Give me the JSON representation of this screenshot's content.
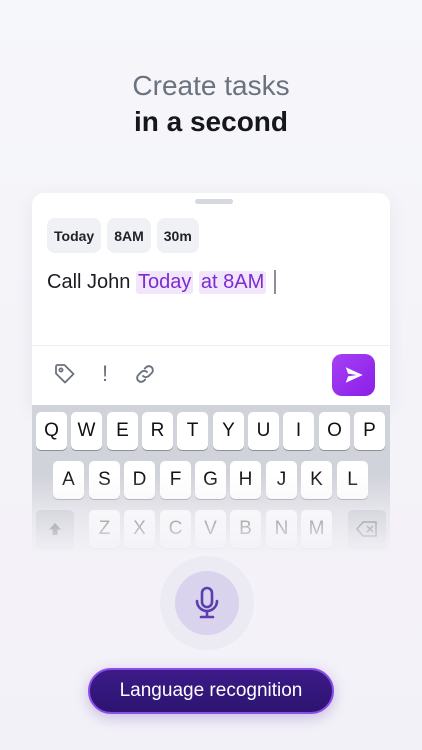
{
  "headline": {
    "line1": "Create tasks",
    "line2": "in a second"
  },
  "chips": [
    {
      "label": "Today"
    },
    {
      "label": "8AM"
    },
    {
      "label": "30m"
    }
  ],
  "task": {
    "text": "Call John",
    "highlight_date": "Today",
    "highlight_time": "at 8AM"
  },
  "toolbar": {
    "priority_symbol": "!"
  },
  "colors": {
    "accent": "#8a1fe6",
    "highlight_bg": "#f1e6fb",
    "highlight_text": "#7c2ccf",
    "button_bg": "#2c1470"
  },
  "keyboard": {
    "row1": [
      "Q",
      "W",
      "E",
      "R",
      "T",
      "Y",
      "U",
      "I",
      "O",
      "P"
    ],
    "row2": [
      "A",
      "S",
      "D",
      "F",
      "G",
      "H",
      "J",
      "K",
      "L"
    ],
    "row3": [
      "Z",
      "X",
      "C",
      "V",
      "B",
      "N",
      "M"
    ]
  },
  "voice_button": {
    "label": "Language recognition"
  }
}
